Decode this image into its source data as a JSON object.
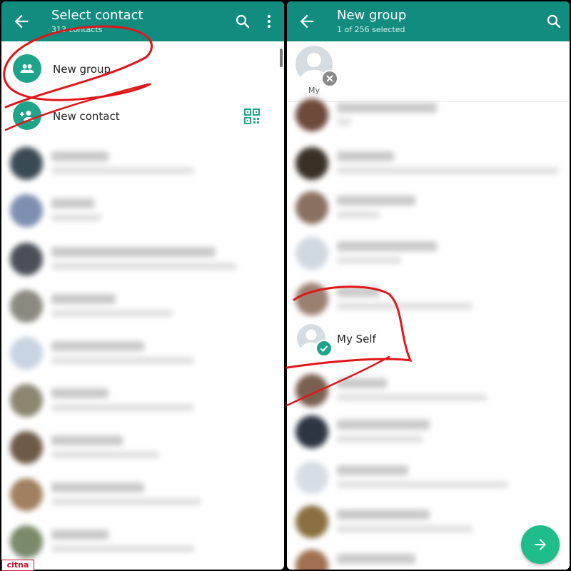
{
  "left_screen": {
    "header": {
      "title": "Select contact",
      "subtitle": "313 contacts"
    },
    "actions": [
      {
        "label": "New group",
        "icon": "group-icon"
      },
      {
        "label": "New contact",
        "icon": "add-person-icon",
        "trailing_icon": "qr-code-icon"
      }
    ]
  },
  "right_screen": {
    "header": {
      "title": "New group",
      "subtitle": "1 of 256 selected"
    },
    "selected_chip": {
      "label": "My"
    },
    "contacts": [
      {
        "label": "My Self",
        "selected": true
      }
    ]
  },
  "colors": {
    "header": "#128C7E",
    "accent": "#1fa38a",
    "fab": "#1fbd8c",
    "annotation": "#e0161a"
  },
  "watermark": "citna"
}
